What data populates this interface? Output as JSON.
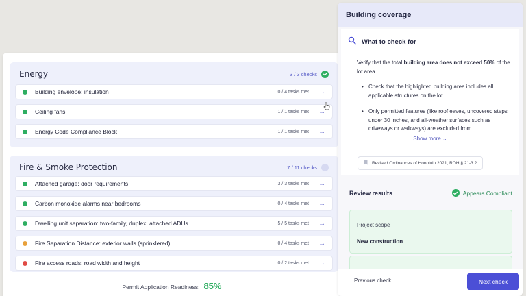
{
  "checklist": {
    "sections": [
      {
        "title": "Energy",
        "count": "3 / 3 checks",
        "status": "complete",
        "items": [
          {
            "label": "Building envelope: insulation",
            "tasks": "0 / 4 tasks met",
            "status": "green"
          },
          {
            "label": "Ceiling fans",
            "tasks": "1 / 1 tasks met",
            "status": "green"
          },
          {
            "label": "Energy Code Compliance Block",
            "tasks": "1 / 1 tasks met",
            "status": "green"
          }
        ]
      },
      {
        "title": "Fire & Smoke Protection",
        "count": "7 / 11 checks",
        "status": "partial",
        "items": [
          {
            "label": "Attached garage: door requirements",
            "tasks": "3 / 3 tasks met",
            "status": "green"
          },
          {
            "label": "Carbon monoxide alarms near bedrooms",
            "tasks": "0 / 4 tasks met",
            "status": "green"
          },
          {
            "label": "Dwelling unit separation: two-family, duplex, attached ADUs",
            "tasks": "5 / 5 tasks met",
            "status": "green"
          },
          {
            "label": "Fire Separation Distance: exterior walls (sprinklered)",
            "tasks": "0 / 4 tasks met",
            "status": "orange"
          },
          {
            "label": "Fire access roads: road width and height",
            "tasks": "0 / 2 tasks met",
            "status": "red"
          }
        ]
      }
    ],
    "readiness_label": "Permit Application Readiness:",
    "readiness_value": "85%"
  },
  "detail": {
    "title": "Building coverage",
    "what_to_check_title": "What to check for",
    "intro_prefix": "Verify that the total ",
    "intro_bold": "building area does not exceed 50%",
    "intro_suffix": " of the lot area.",
    "bullets": [
      "Check that the highlighted building area includes all applicable structures on the lot",
      "Only permitted features (like roof eaves, uncovered steps under 30 inches, and all-weather surfaces such as driveways or walkways) are excluded from"
    ],
    "show_more": "Show more",
    "citation": "Revised Ordinances of Honolulu 2021, ROH § 21-3.2",
    "review_title": "Review results",
    "review_status": "Appears Compliant",
    "scope_label": "Project scope",
    "scope_value": "New construction",
    "prev_label": "Previous check",
    "next_label": "Next check"
  },
  "colors": {
    "accent": "#4b4fd6",
    "success": "#2fae62",
    "warning": "#e8a13b",
    "error": "#e04b45"
  },
  "icons": {
    "search": "magnifier-icon",
    "arrow": "arrow-right-icon",
    "check": "check-icon",
    "bookmark": "bookmark-icon",
    "chevron": "chevron-down-icon"
  }
}
